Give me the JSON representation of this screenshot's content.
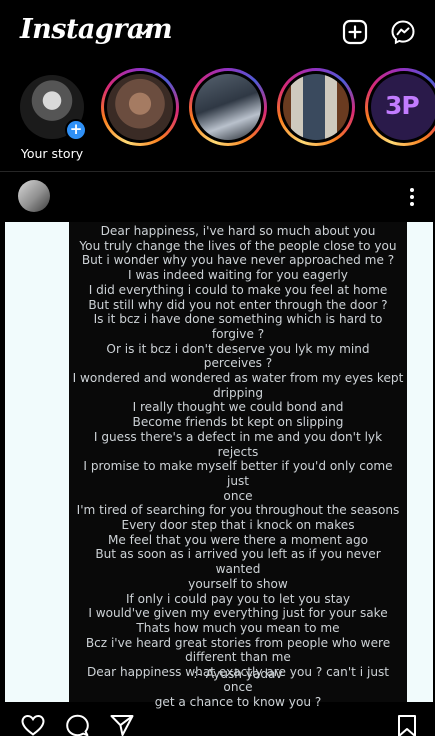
{
  "header": {
    "app_title": "Instagram",
    "icons": [
      "chevron-down-icon",
      "new-post-icon",
      "messenger-icon"
    ]
  },
  "stories": {
    "own_label": "Your story",
    "story4_badge": "3P"
  },
  "post": {
    "lines": [
      "Dear happiness, i've hard so much about you",
      "You truly change the lives of the people close to you",
      "But i wonder why you have never approached me ?",
      "I was indeed waiting for you eagerly",
      "I did everything i could to make you feel at home",
      "But still why did you not enter through the door ?",
      "Is it bcz i have done something which is hard to",
      "forgive ?",
      "Or is it bcz i don't deserve you lyk my mind",
      "perceives ?",
      "I wondered and wondered as water from my eyes kept",
      "dripping",
      "I really thought we could bond and",
      "Become friends bt kept on slipping",
      "I guess there's a defect in me and you don't lyk rejects",
      "I promise to make myself better if you'd only come just",
      "once",
      "I'm tired of searching for you throughout the seasons",
      "Every door step that i knock on makes",
      "Me feel that you were there a moment ago",
      "But as soon as i arrived you left as if you never wanted",
      "yourself to show",
      "If only i could pay you to let you stay",
      "I would've given my everything just for your sake",
      "Thats how much you mean to me",
      "Bcz i've heard great stories from people who were",
      "different than me",
      "Dear happiness what exactly are you ? can't i just once",
      "get a chance to know you ?"
    ],
    "author": ":- Ayush yadav"
  },
  "actions": {
    "icons": [
      "heart-icon",
      "comment-icon",
      "share-icon",
      "bookmark-icon"
    ]
  },
  "colors": {
    "background": "#000000",
    "poem_text": "#cdd2d6",
    "post_margin": "#f1fbfc",
    "add_badge": "#2f90f6",
    "story_ring": [
      "#feda75",
      "#fa7e1e",
      "#d62976",
      "#962fbf",
      "#4f5bd5"
    ]
  }
}
